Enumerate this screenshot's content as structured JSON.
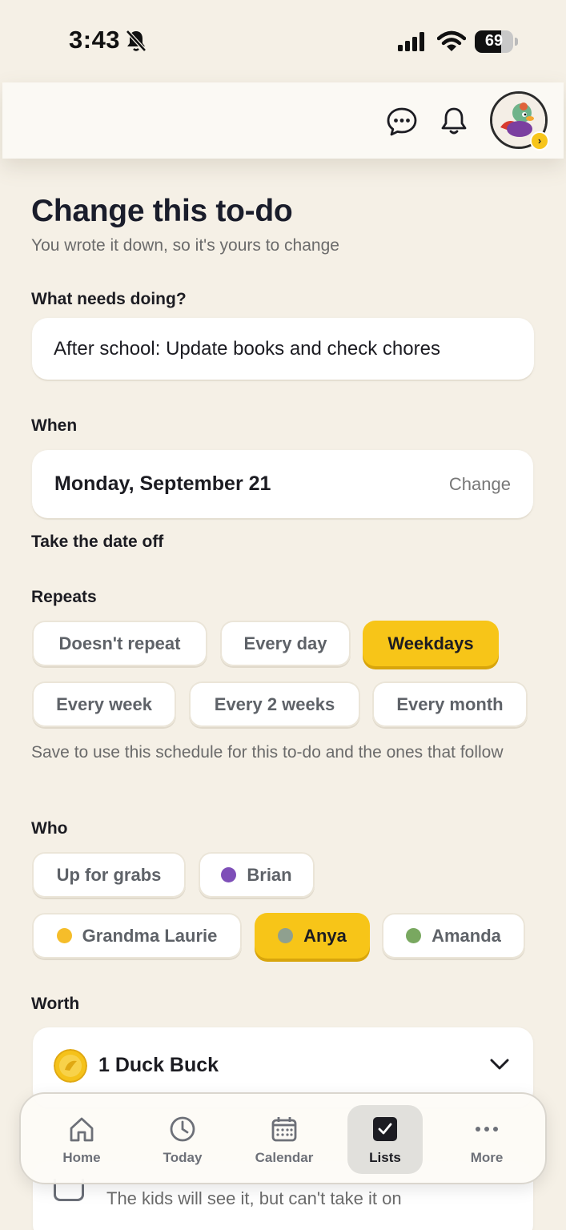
{
  "status_bar": {
    "time": "3:43",
    "battery": "69",
    "battery_level": 0.69
  },
  "header": {
    "chat_icon": "chat-bubble-icon",
    "bell_icon": "bell-icon",
    "avatar": "avatar"
  },
  "page": {
    "title": "Change this to-do",
    "subtitle": "You wrote it down, so it's yours to change"
  },
  "task": {
    "label": "What needs doing?",
    "value": "After school: Update books and check chores"
  },
  "when": {
    "label": "When",
    "date": "Monday, September 21",
    "change_label": "Change",
    "remove_date_label": "Take the date off"
  },
  "repeats": {
    "label": "Repeats",
    "options": [
      "Doesn't repeat",
      "Every day",
      "Weekdays",
      "Every week",
      "Every 2 weeks",
      "Every month"
    ],
    "selected": "Weekdays",
    "help": "Save to use this schedule for this to-do and the ones that follow"
  },
  "who": {
    "label": "Who",
    "options": [
      {
        "name": "Up for grabs",
        "color": ""
      },
      {
        "name": "Brian",
        "color": "#7e4fb8"
      },
      {
        "name": "Grandma Laurie",
        "color": "#f5bd2a"
      },
      {
        "name": "Anya",
        "color": "#8fa08f"
      },
      {
        "name": "Amanda",
        "color": "#79a860"
      }
    ],
    "selected": "Anya"
  },
  "worth": {
    "label": "Worth",
    "value": "1 Duck Buck"
  },
  "private": {
    "text": "The kids will see it, but can't take it on"
  },
  "tab_bar": {
    "tabs": [
      {
        "label": "Home",
        "icon": "home-icon"
      },
      {
        "label": "Today",
        "icon": "clock-icon"
      },
      {
        "label": "Calendar",
        "icon": "calendar-icon"
      },
      {
        "label": "Lists",
        "icon": "checkbox-icon"
      },
      {
        "label": "More",
        "icon": "more-dots-icon"
      }
    ],
    "active": "Lists"
  }
}
